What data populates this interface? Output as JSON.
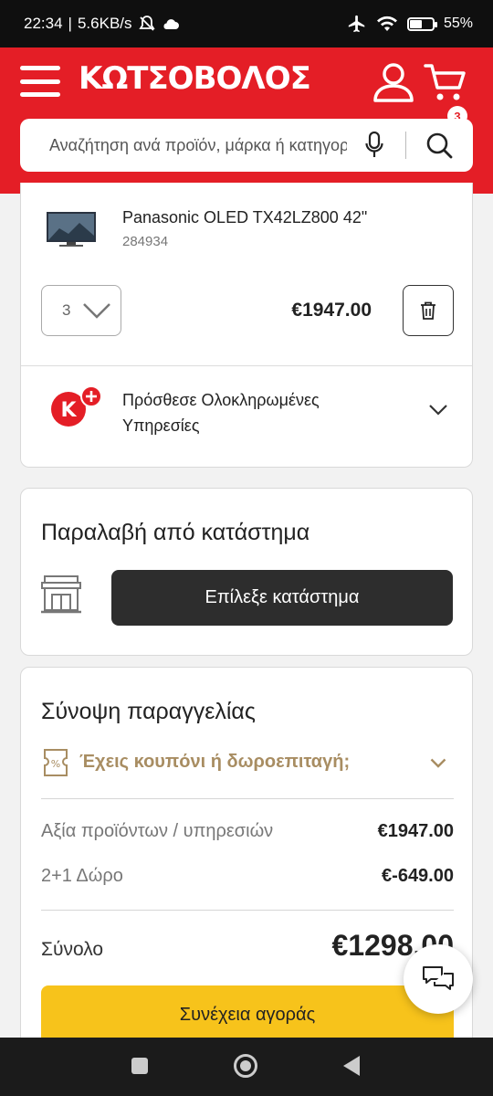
{
  "status_bar": {
    "time": "22:34",
    "net_speed": "5.6KB/s",
    "battery_percent": "55%",
    "battery_level": 0.55
  },
  "header": {
    "logo": "ΚΩΤΣΟΒΟΛΟΣ",
    "cart_count": "3",
    "search_placeholder": "Αναζήτηση ανά προϊόν, μάρκα ή κατηγορία"
  },
  "cart_item": {
    "name": "Panasonic OLED TX42LZ800 42\"",
    "code": "284934",
    "quantity": "3",
    "price": "€1947.00",
    "services_label": "Πρόσθεσε Ολοκληρωμένες Υπηρεσίες"
  },
  "pickup": {
    "title": "Παραλαβή από κατάστημα",
    "button_label": "Επίλεξε κατάστημα"
  },
  "summary": {
    "title": "Σύνοψη παραγγελίας",
    "coupon_label": "Έχεις κουπόνι ή δωροεπιταγή;",
    "rows": [
      {
        "label": "Αξία προϊόντων / υπηρεσιών",
        "value": "€1947.00"
      },
      {
        "label": "2+1 Δώρο",
        "value": "€-649.00"
      }
    ],
    "total_label": "Σύνολο",
    "total_value": "€1298.00",
    "continue_label": "Συνέχεια αγοράς"
  },
  "colors": {
    "brand_red": "#e41e26",
    "accent_yellow": "#f7c31b",
    "coupon_gold": "#a88d62"
  },
  "icons": [
    "menu-icon",
    "user-icon",
    "cart-icon",
    "mic-icon",
    "search-icon",
    "chevron-down-icon",
    "trash-icon",
    "kplus-icon",
    "store-icon",
    "coupon-icon",
    "chat-icon"
  ]
}
